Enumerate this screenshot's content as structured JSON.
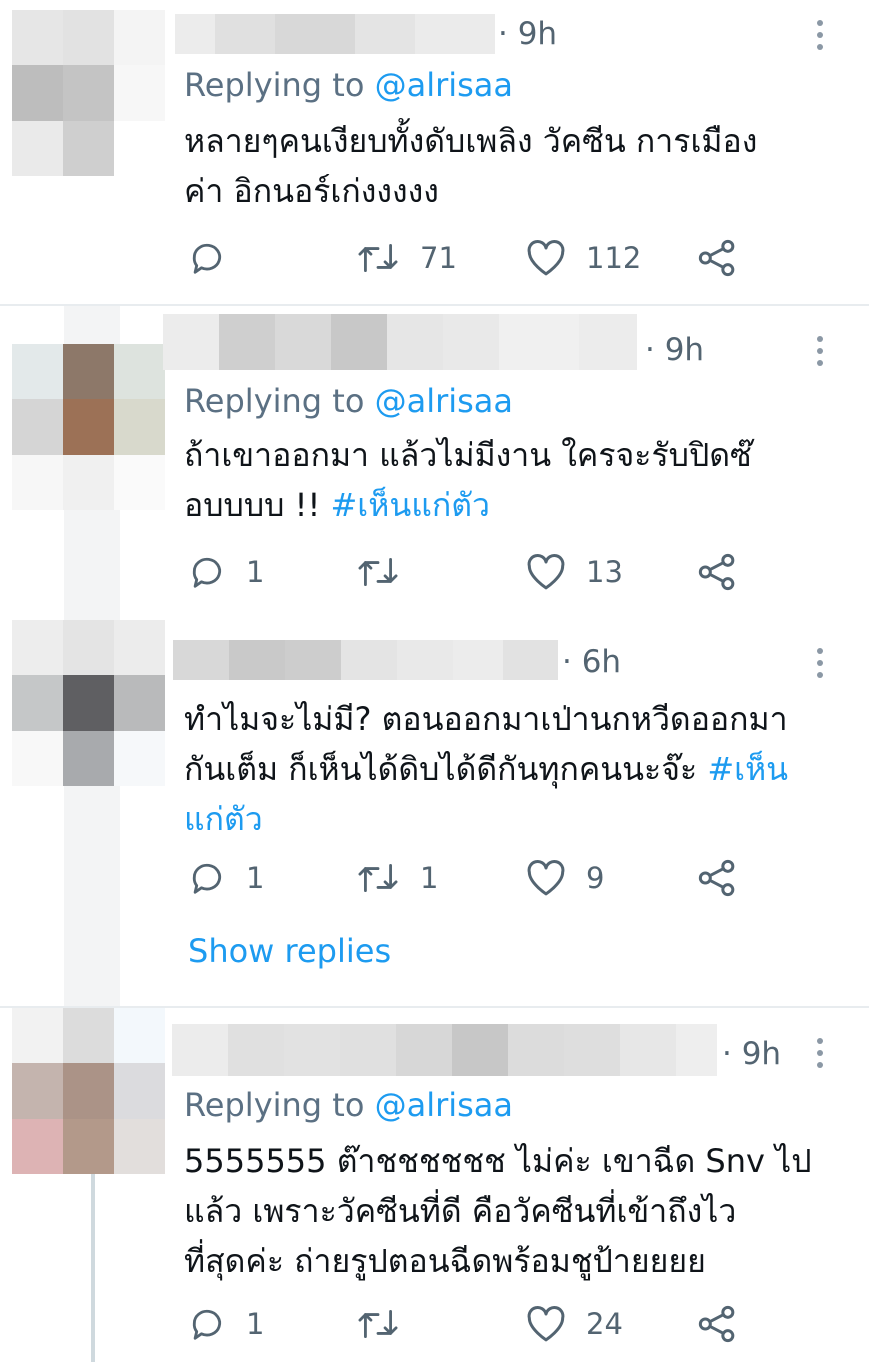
{
  "tweets": [
    {
      "time": "· 9h",
      "replying_label": "Replying to ",
      "replying_handle": "@alrisaa",
      "text_lines": [
        "หลายๆคนเงียบทั้งดับเพลิง วัคซีน การเมือง",
        "ค่า อิกนอร์เก่งงงงง"
      ],
      "reply_count": "",
      "retweet_count": "71",
      "like_count": "112"
    },
    {
      "time": "· 9h",
      "replying_label": "Replying to ",
      "replying_handle": "@alrisaa",
      "text_line1": "ถ้าเขาออกมา แล้วไม่มีงาน  ใครจะรับปิดซ๊",
      "text_line2": "อบบบบ !! ",
      "hashtag": "#เห็นแก่ตัว",
      "reply_count": "1",
      "retweet_count": "",
      "like_count": "13"
    },
    {
      "time": "· 6h",
      "text_line1": "ทำไมจะไม่มี? ตอนออกมาเป่านกหวีดออกมา",
      "text_line2": "กันเต็ม ก็เห็นได้ดิบได้ดีกันทุกคนนะจ๊ะ ",
      "hashtag_part1": "#เห็น",
      "hashtag_part2": "แก่ตัว",
      "reply_count": "1",
      "retweet_count": "1",
      "like_count": "9",
      "show_replies": "Show replies"
    },
    {
      "time": "· 9h",
      "replying_label": "Replying to ",
      "replying_handle": "@alrisaa",
      "text_lines": [
        "5555555 ต๊าชชชชชช ไม่ค่ะ เขาฉีด Snv ไป",
        "แล้ว เพราะวัคซีนที่ดี คือวัคซีนที่เข้าถึงไว",
        "ที่สุดค่ะ ถ่ายรูปตอนฉีดพร้อมชูป้ายยยย"
      ],
      "reply_count": "1",
      "retweet_count": "",
      "like_count": "24"
    }
  ],
  "icons": {
    "reply": "reply-icon",
    "retweet": "retweet-icon",
    "like": "heart-icon",
    "share": "share-icon",
    "more": "more-icon"
  },
  "colors": {
    "accent": "#1d9bf0",
    "muted": "#536471",
    "separator": "#e8ecef"
  }
}
